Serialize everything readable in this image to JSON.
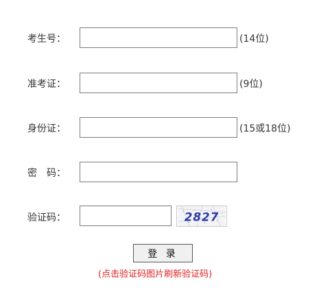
{
  "form": {
    "candidate_number": {
      "label": "考生号：",
      "value": "",
      "hint": "(14位)"
    },
    "admission_number": {
      "label": "准考证：",
      "value": "",
      "hint": "(9位)"
    },
    "id_card": {
      "label": "身份证：",
      "value": "",
      "hint": "(15或18位)"
    },
    "password": {
      "label": "密　码：",
      "value": ""
    },
    "captcha": {
      "label": "验证码：",
      "value": "",
      "image_text": "2827"
    }
  },
  "login_button_label": "登 录",
  "refresh_note": "(点击验证码图片刷新验证码)",
  "colors": {
    "note": "#e02020",
    "captcha_text": "#2a3aa8"
  }
}
